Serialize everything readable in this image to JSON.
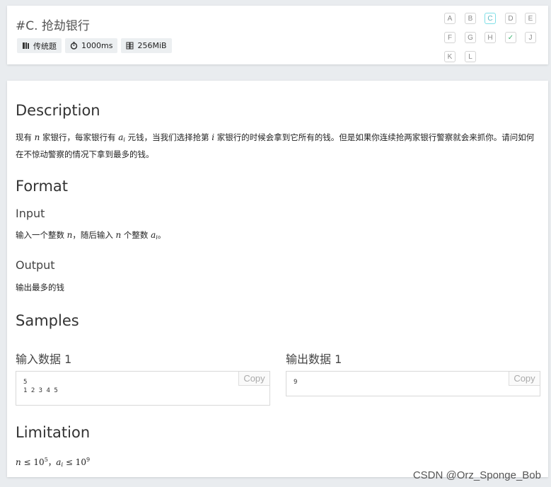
{
  "header": {
    "title": "#C. 抢劫银行",
    "badges": [
      {
        "icon": "book-icon",
        "label": "传统题"
      },
      {
        "icon": "stopwatch-icon",
        "label": "1000ms"
      },
      {
        "icon": "memory-icon",
        "label": "256MiB"
      }
    ],
    "problems": [
      {
        "label": "A",
        "state": "normal"
      },
      {
        "label": "B",
        "state": "normal"
      },
      {
        "label": "C",
        "state": "active"
      },
      {
        "label": "D",
        "state": "normal"
      },
      {
        "label": "E",
        "state": "normal"
      },
      {
        "label": "F",
        "state": "normal"
      },
      {
        "label": "G",
        "state": "normal"
      },
      {
        "label": "H",
        "state": "normal"
      },
      {
        "label": "✓",
        "state": "solved"
      },
      {
        "label": "J",
        "state": "normal"
      },
      {
        "label": "K",
        "state": "normal"
      },
      {
        "label": "L",
        "state": "normal"
      }
    ]
  },
  "description": {
    "heading": "Description",
    "parts": [
      "现有 ",
      "n",
      " 家银行，每家银行有 ",
      "a",
      "i",
      " 元钱，当我们选择抢第 ",
      "i",
      " 家银行的时候会拿到它所有的钱。但是如果你连续抢两家银行警察就会来抓你。请问如何在不惊动警察的情况下拿到最多的钱。"
    ]
  },
  "format": {
    "heading": "Format",
    "input_heading": "Input",
    "input_parts": [
      "输入一个整数 ",
      "n",
      "，随后输入 ",
      "n",
      " 个整数 ",
      "a",
      "i",
      "。"
    ],
    "output_heading": "Output",
    "output_text": "输出最多的钱"
  },
  "samples": {
    "heading": "Samples",
    "input_label": "输入数据 1",
    "input_text": "5\n1 2 3 4 5",
    "output_label": "输出数据 1",
    "output_text": "9",
    "copy_label": "Copy"
  },
  "limitation": {
    "heading": "Limitation",
    "parts": [
      "n",
      " ≤ 10",
      "5",
      "，",
      "a",
      "i",
      " ≤ 10",
      "9"
    ]
  },
  "watermark": "CSDN @Orz_Sponge_Bob",
  "colors": {
    "page_bg": "#e9ecef",
    "active_border": "#7fe0e8",
    "solved": "#3cb371"
  }
}
